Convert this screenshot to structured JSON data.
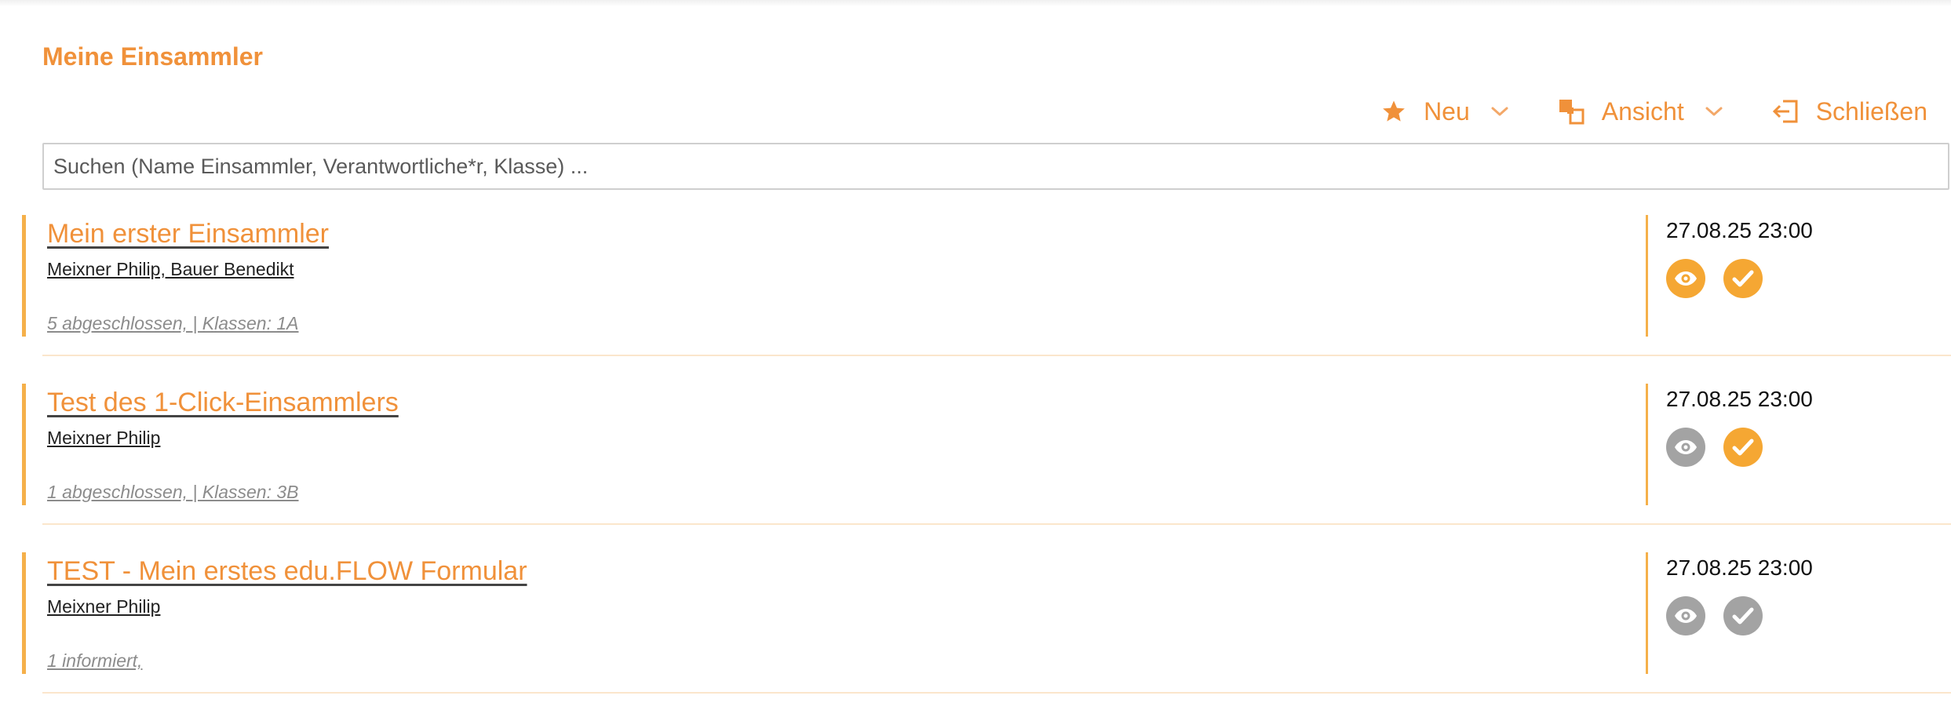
{
  "page": {
    "title": "Meine Einsammler"
  },
  "toolbar": {
    "new_label": "Neu",
    "view_label": "Ansicht",
    "close_label": "Schließen"
  },
  "search": {
    "placeholder": "Suchen (Name Einsammler, Verantwortliche*r, Klasse) ..."
  },
  "colors": {
    "accent": "#f0913a",
    "icon_active": "#f5a733",
    "icon_inactive": "#a3a3a3",
    "bar": "#f5b04a"
  },
  "collectors": [
    {
      "name": "Mein erster Einsammler",
      "persons": "Meixner Philip, Bauer Benedikt",
      "meta": "5 abgeschlossen, | Klassen: 1A",
      "date": "27.08.25 23:00",
      "view_active": true,
      "check_active": true
    },
    {
      "name": "Test des 1-Click-Einsammlers",
      "persons": "Meixner Philip",
      "meta": "1 abgeschlossen, | Klassen: 3B",
      "date": "27.08.25 23:00",
      "view_active": false,
      "check_active": true
    },
    {
      "name": "TEST - Mein erstes edu.FLOW Formular",
      "persons": "Meixner Philip",
      "meta": "1 informiert,",
      "date": "27.08.25 23:00",
      "view_active": false,
      "check_active": false
    }
  ]
}
